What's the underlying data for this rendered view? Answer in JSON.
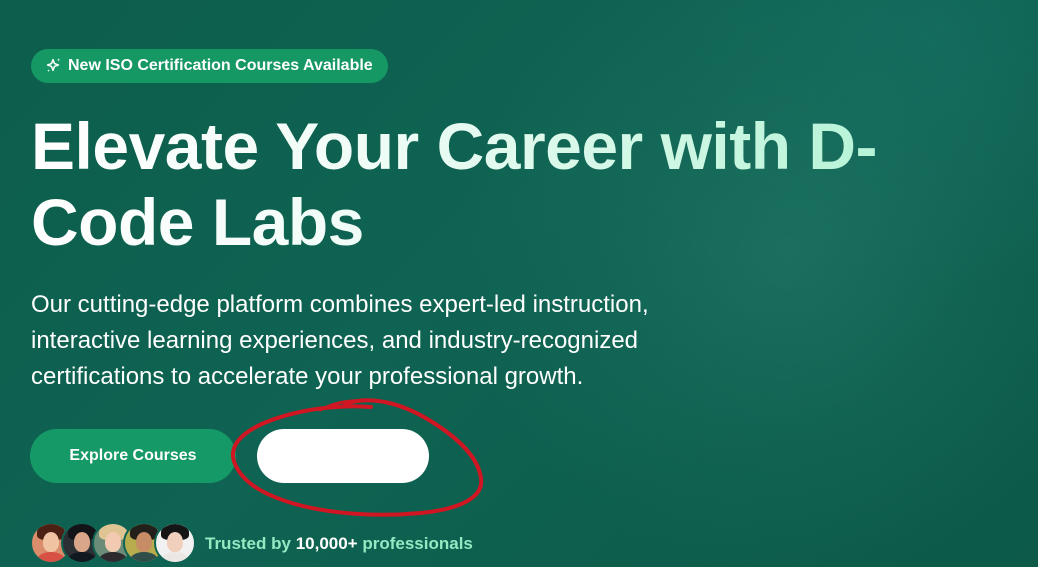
{
  "badge": {
    "icon": "sparkles-icon",
    "text": "New ISO Certification Courses Available"
  },
  "hero": {
    "title": "Elevate Your Career with D-Code Labs",
    "subtitle": "Our cutting-edge platform combines expert-led instruction, interactive learning experiences, and industry-recognized certifications to accelerate your professional growth."
  },
  "actions": {
    "primary_label": "Explore Courses",
    "secondary_label": ""
  },
  "trust": {
    "prefix": "Trusted by ",
    "count": "10,000+",
    "suffix": " professionals"
  },
  "colors": {
    "background": "#0f6352",
    "badge": "#169865",
    "primary_button": "#159a67",
    "secondary_button": "#ffffff",
    "accent_text": "#92e9c2",
    "annotation": "#d01622"
  }
}
